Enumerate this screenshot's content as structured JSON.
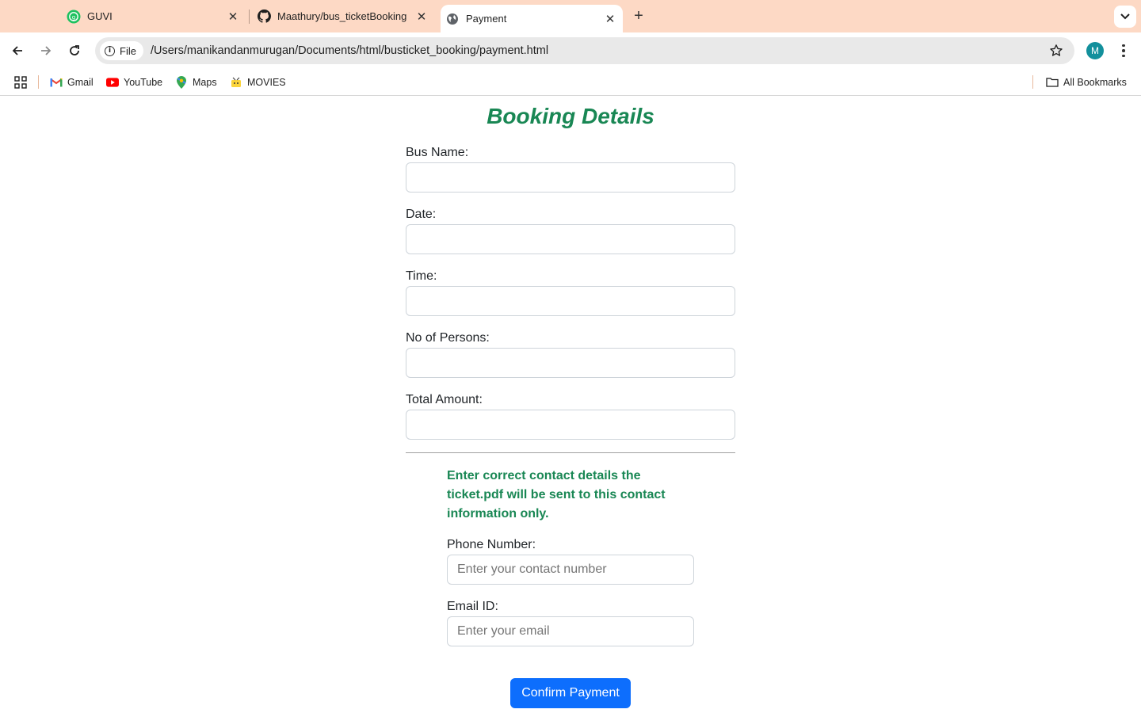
{
  "browser": {
    "tabs": [
      {
        "title": "GUVI",
        "icon": "guvi-icon"
      },
      {
        "title": "Maathury/bus_ticketBooking",
        "icon": "github-icon"
      },
      {
        "title": "Payment",
        "icon": "globe-icon",
        "active": true
      }
    ],
    "address_chip": "File",
    "url": "/Users/manikandanmurugan/Documents/html/busticket_booking/payment.html",
    "profile_initial": "M",
    "bookmarks": [
      {
        "label": "Gmail",
        "icon": "gmail-icon"
      },
      {
        "label": "YouTube",
        "icon": "youtube-icon"
      },
      {
        "label": "Maps",
        "icon": "maps-icon"
      },
      {
        "label": "MOVIES",
        "icon": "movies-icon"
      }
    ],
    "all_bookmarks": "All Bookmarks",
    "colors": {
      "tabstrip": "#fdd9c5",
      "avatar": "#13909c"
    }
  },
  "page": {
    "heading": "Booking Details",
    "fields": {
      "bus_name": {
        "label": "Bus Name:",
        "value": ""
      },
      "date": {
        "label": "Date:",
        "value": ""
      },
      "time": {
        "label": "Time:",
        "value": ""
      },
      "persons": {
        "label": "No of Persons:",
        "value": ""
      },
      "total": {
        "label": "Total Amount:",
        "value": ""
      }
    },
    "notice": "Enter correct contact details the ticket.pdf will be sent to this contact information only.",
    "phone": {
      "label": "Phone Number:",
      "placeholder": "Enter your contact number"
    },
    "email": {
      "label": "Email ID:",
      "placeholder": "Enter your email"
    },
    "confirm_button": "Confirm Payment",
    "colors": {
      "heading": "#198754",
      "button": "#0d6efd"
    }
  }
}
